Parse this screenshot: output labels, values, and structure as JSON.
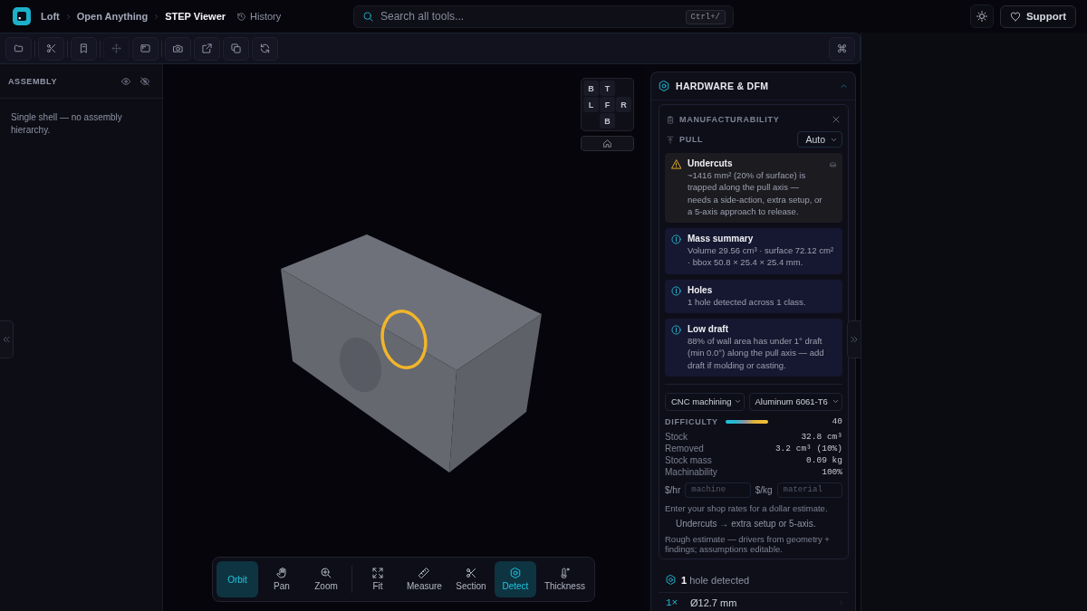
{
  "app_bar": {
    "breadcrumbs": [
      {
        "label": "Loft",
        "current": false
      },
      {
        "label": "Open Anything",
        "current": false
      },
      {
        "label": "STEP Viewer",
        "current": true
      }
    ],
    "history_link": "History",
    "search": {
      "placeholder": "Search all tools...",
      "shortcut": "Ctrl+/"
    },
    "support_button": "Support"
  },
  "toolbar": {
    "groups": [
      {
        "buttons": [
          {
            "disabled": false
          }
        ]
      },
      {
        "buttons": [
          {
            "disabled": false
          }
        ]
      },
      {
        "buttons": [
          {
            "disabled": false
          }
        ]
      },
      {
        "buttons": [
          {
            "disabled": true
          },
          {
            "disabled": false
          }
        ]
      },
      {
        "buttons": [
          {
            "disabled": false
          },
          {
            "disabled": false
          },
          {
            "disabled": false
          },
          {
            "disabled": false
          }
        ]
      }
    ]
  },
  "assembly_panel": {
    "title": "ASSEMBLY",
    "message": "Single shell — no assembly hierarchy."
  },
  "viewport": {
    "view_cube": {
      "top_row": [
        "B",
        "T"
      ],
      "middle_row": [
        "L",
        "F",
        "R"
      ],
      "bottom_row": [
        "B"
      ]
    },
    "tool_groups": [
      {
        "tools": [
          {
            "label": "Orbit",
            "selected": true
          },
          {
            "label": "Pan",
            "selected": false
          },
          {
            "label": "Zoom",
            "selected": false
          }
        ]
      },
      {
        "tools": [
          {
            "label": "Fit",
            "selected": false
          },
          {
            "label": "Measure",
            "selected": false
          },
          {
            "label": "Section",
            "selected": false
          },
          {
            "label": "Detect",
            "selected": true
          },
          {
            "label": "Thickness",
            "selected": false
          }
        ]
      }
    ]
  },
  "dfm_panel": {
    "title": "HARDWARE & DFM",
    "expanded": true,
    "manufacturability": {
      "title": "MANUFACTURABILITY",
      "pull": {
        "label": "PULL",
        "value": "Auto"
      },
      "findings": [
        {
          "kind": "warning",
          "title": "Undercuts",
          "text": "~1416 mm² (20% of surface) is trapped along the pull axis — needs a side-action, extra setup, or a 5-axis approach to release."
        },
        {
          "kind": "info",
          "title": "Mass summary",
          "text": "Volume 29.56 cm³ · surface 72.12 cm² · bbox 50.8 × 25.4 × 25.4 mm."
        },
        {
          "kind": "info",
          "title": "Holes",
          "text": "1 hole detected across 1 class."
        },
        {
          "kind": "info",
          "title": "Low draft",
          "text": "88% of wall area has under 1° draft (min 0.0°) along the pull axis — add draft if molding or casting."
        }
      ],
      "process": "CNC machining",
      "material": "Aluminum 6061-T6",
      "difficulty": {
        "label": "DIFFICULTY",
        "value": "40"
      },
      "stats": [
        {
          "label": "Stock",
          "value": "32.8 cm³"
        },
        {
          "label": "Removed",
          "value": "3.2 cm³ (10%)"
        },
        {
          "label": "Stock mass",
          "value": "0.09 kg"
        },
        {
          "label": "Machinability",
          "value": "100%"
        }
      ],
      "rates": [
        {
          "unit": "$/hr",
          "placeholder": "machine"
        },
        {
          "unit": "$/kg",
          "placeholder": "material"
        }
      ],
      "notes": [
        {
          "kind": "note",
          "text": "Enter your shop rates for a dollar estimate."
        },
        {
          "kind": "driver",
          "text": "Undercuts → extra setup or 5-axis."
        },
        {
          "kind": "note",
          "text": "Rough estimate — drivers from geometry + findings; assumptions editable."
        }
      ]
    },
    "holes_summary": "**1** hole detected",
    "hole_classes": [
      {
        "count": "1×",
        "diameter": "Ø12.7 mm"
      }
    ]
  }
}
